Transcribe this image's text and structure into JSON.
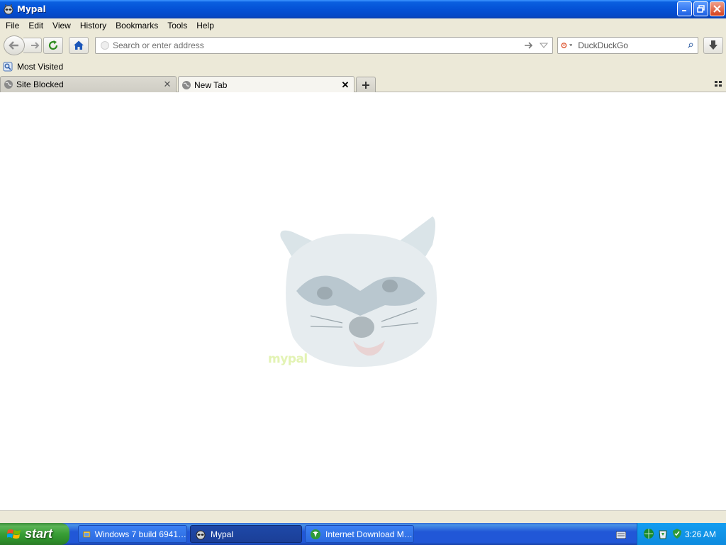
{
  "window": {
    "title": "Mypal"
  },
  "menu": [
    "File",
    "Edit",
    "View",
    "History",
    "Bookmarks",
    "Tools",
    "Help"
  ],
  "nav": {
    "url_placeholder": "Search or enter address",
    "search_engine": "DuckDuckGo",
    "search_placeholder": "DuckDuckGo"
  },
  "bookmarks": {
    "most_visited": "Most Visited"
  },
  "tabs": [
    {
      "label": "Site Blocked",
      "active": false
    },
    {
      "label": "New Tab",
      "active": true
    }
  ],
  "content": {
    "logo_text": "mypal"
  },
  "taskbar": {
    "start_label": "start",
    "tasks": [
      {
        "label": "Windows 7 build 6941…",
        "active": false
      },
      {
        "label": "Mypal",
        "active": true
      },
      {
        "label": "Internet Download M…",
        "active": false
      }
    ],
    "clock": "3:26 AM"
  },
  "colors": {
    "titlebar": "#0451d6",
    "chrome": "#ece9d8",
    "start": "#389e35",
    "taskbar": "#2157d7",
    "tray": "#0d8bdf"
  }
}
